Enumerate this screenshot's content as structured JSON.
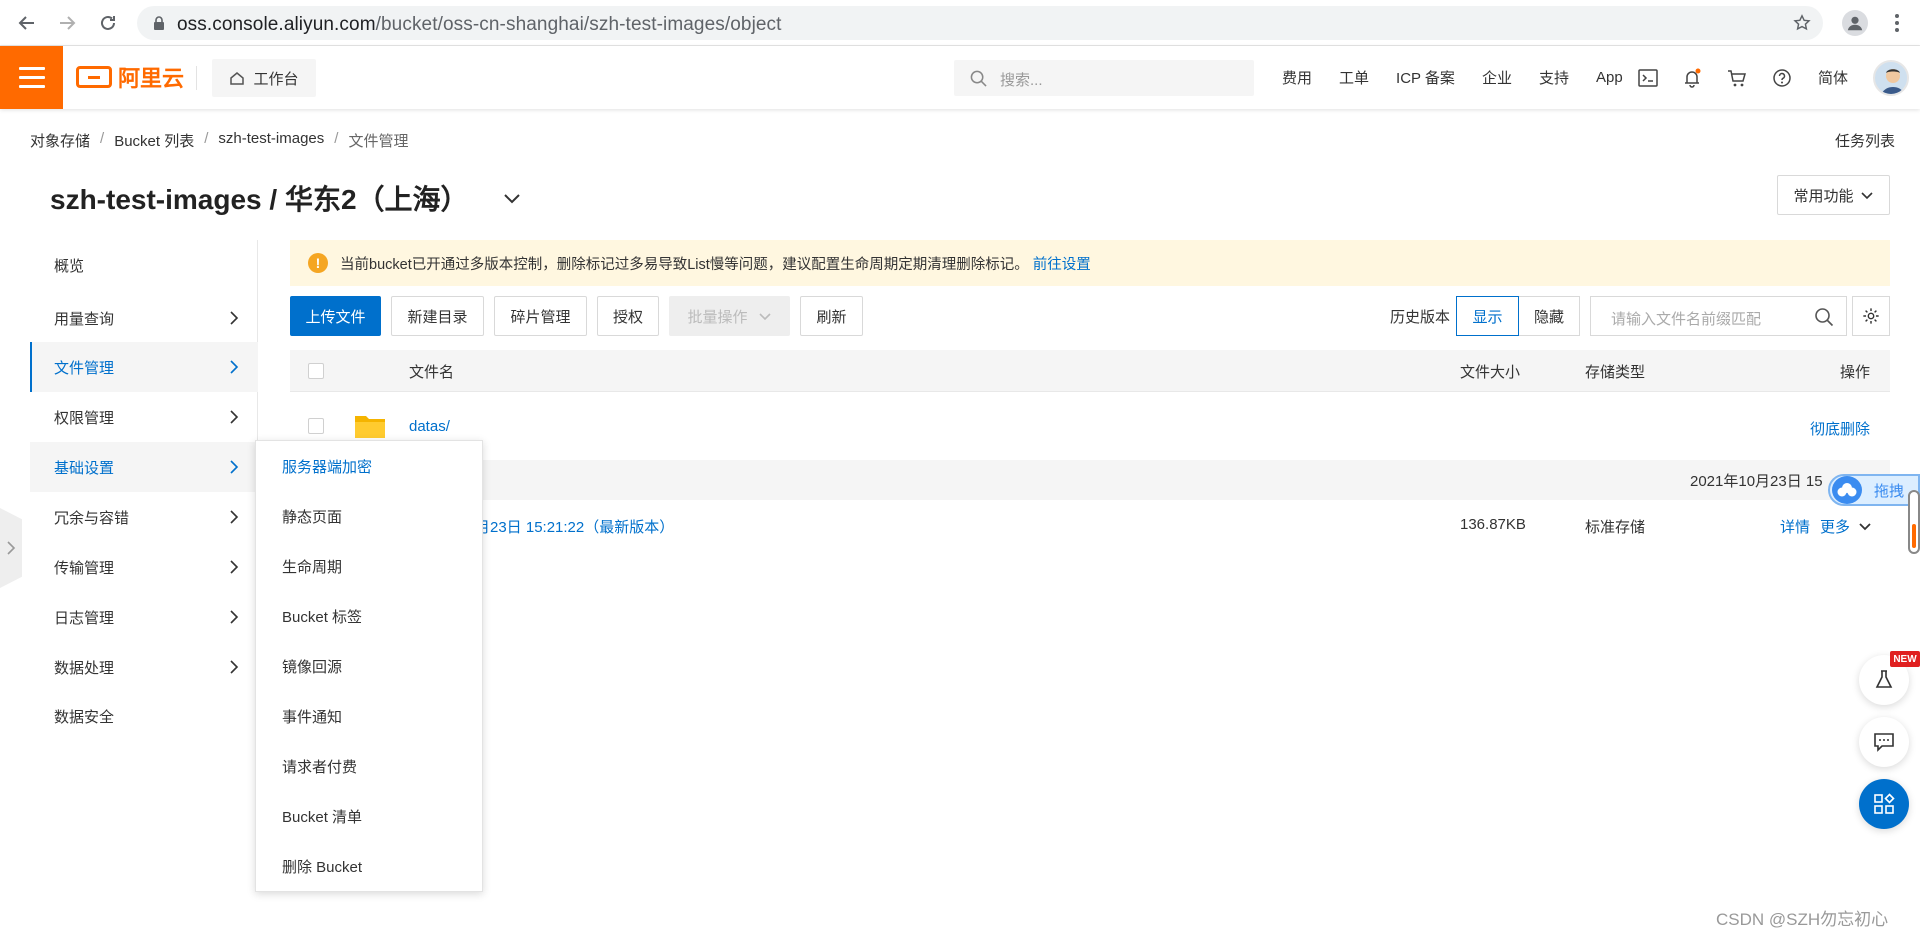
{
  "browser": {
    "url_host": "oss.console.aliyun.com",
    "url_path": "/bucket/oss-cn-shanghai/szh-test-images/object"
  },
  "topbar": {
    "logo_text": "阿里云",
    "workbench_label": "工作台",
    "search_placeholder": "搜索...",
    "links": [
      "费用",
      "工单",
      "ICP 备案",
      "企业",
      "支持",
      "App"
    ],
    "lang": "简体"
  },
  "breadcrumb": {
    "items": [
      "对象存储",
      "Bucket 列表",
      "szh-test-images",
      "文件管理"
    ],
    "separator": "/"
  },
  "task_list": "任务列表",
  "page_title": "szh-test-images / 华东2（上海）",
  "common_functions": "常用功能",
  "sidebar": {
    "items": [
      {
        "label": "概览",
        "has_arrow": false
      },
      {
        "label": "用量查询",
        "has_arrow": true
      },
      {
        "label": "文件管理",
        "has_arrow": true,
        "state": "active"
      },
      {
        "label": "权限管理",
        "has_arrow": true
      },
      {
        "label": "基础设置",
        "has_arrow": true,
        "state": "hover"
      },
      {
        "label": "冗余与容错",
        "has_arrow": true
      },
      {
        "label": "传输管理",
        "has_arrow": true
      },
      {
        "label": "日志管理",
        "has_arrow": true
      },
      {
        "label": "数据处理",
        "has_arrow": true
      },
      {
        "label": "数据安全",
        "has_arrow": false
      }
    ]
  },
  "submenu": {
    "items": [
      "服务器端加密",
      "静态页面",
      "生命周期",
      "Bucket 标签",
      "镜像回源",
      "事件通知",
      "请求者付费",
      "Bucket 清单",
      "删除 Bucket"
    ]
  },
  "notice": {
    "text": "当前bucket已开通过多版本控制，删除标记过多易导致List慢等问题，建议配置生命周期定期清理删除标记。",
    "link": "前往设置"
  },
  "toolbar": {
    "upload": "上传文件",
    "new_dir": "新建目录",
    "fragments": "碎片管理",
    "authorize": "授权",
    "batch": "批量操作",
    "refresh": "刷新",
    "history_label": "历史版本",
    "show": "显示",
    "hide": "隐藏",
    "filter_placeholder": "请输入文件名前缀匹配"
  },
  "table": {
    "headers": {
      "name": "文件名",
      "size": "文件大小",
      "storage": "存储类型",
      "actions": "操作"
    },
    "rows": [
      {
        "name": "datas/",
        "action": "彻底删除"
      }
    ],
    "date_header": "2021年10月23日 15",
    "version_row": {
      "name_fragment": "月23日 15:21:22（最新版本）",
      "size": "136.87KB",
      "storage": "标准存储",
      "details": "详情",
      "more": "更多"
    }
  },
  "floating": {
    "tag_text": "拖拽",
    "new_badge": "NEW"
  },
  "watermark": "CSDN @SZH勿忘初心",
  "colors": {
    "brand": "#ff6a00",
    "primary": "#0070cc",
    "notice_bg": "#fff7e0"
  }
}
